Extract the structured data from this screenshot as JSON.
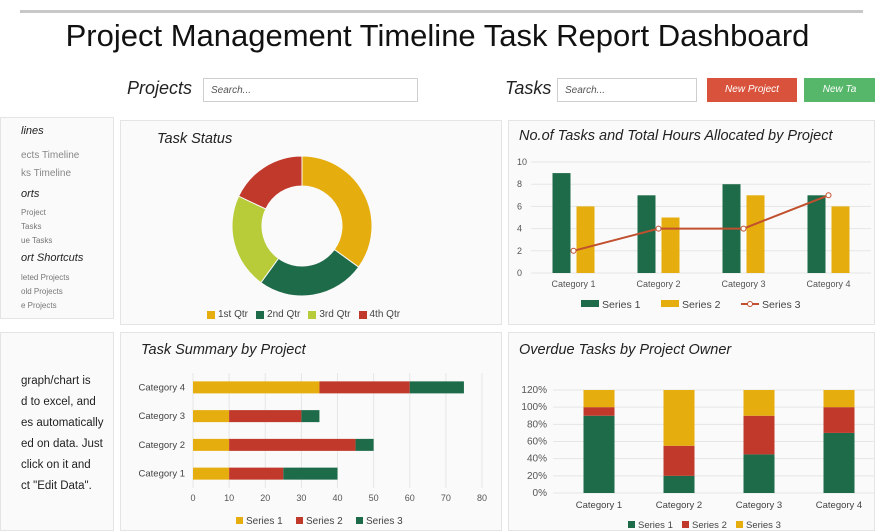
{
  "header": {
    "title": "Project Management Timeline Task Report Dashboard"
  },
  "toolbar": {
    "projects_label": "Projects",
    "projects_search_placeholder": "Search...",
    "tasks_label": "Tasks",
    "tasks_search_placeholder": "Search...",
    "new_project_label": "New Project",
    "new_task_label": "New Ta"
  },
  "sidebar": {
    "timelines_heading": "lines",
    "projects_timeline": "ects Timeline",
    "tasks_timeline": "ks Timeline",
    "reports_heading": "orts",
    "report_project": "Project",
    "report_tasks": "Tasks",
    "report_overdue": "ue Tasks",
    "shortcuts_heading": "ort Shortcuts",
    "shortcut_completed": "leted Projects",
    "shortcut_old": "old Projects",
    "shortcut_active": "e Projects"
  },
  "info": {
    "lines": [
      "graph/chart is",
      "d to excel, and",
      "es automatically",
      "ed on data. Just",
      "click on it and",
      "ct \"Edit Data\"."
    ]
  },
  "colors": {
    "green": "#1e6b4a",
    "gold": "#e5ad0e",
    "red": "#c0392b",
    "lime": "#b8cc3a",
    "line": "#c0502e"
  },
  "chart_data": [
    {
      "type": "pie",
      "title": "Task Status",
      "categories": [
        "1st Qtr",
        "2nd Qtr",
        "3rd Qtr",
        "4th Qtr"
      ],
      "values": [
        35,
        25,
        22,
        18
      ],
      "colors": [
        "#e5ad0e",
        "#1e6b4a",
        "#b8cc3a",
        "#c0392b"
      ]
    },
    {
      "type": "bar",
      "title": "No.of Tasks and Total Hours Allocated by Project",
      "categories": [
        "Category 1",
        "Category 2",
        "Category 3",
        "Category 4"
      ],
      "series": [
        {
          "name": "Series 1",
          "kind": "bar",
          "color": "#1e6b4a",
          "values": [
            9,
            7,
            8,
            7
          ]
        },
        {
          "name": "Series 2",
          "kind": "bar",
          "color": "#e5ad0e",
          "values": [
            6,
            5,
            7,
            6
          ]
        },
        {
          "name": "Series 3",
          "kind": "line",
          "color": "#c0502e",
          "values": [
            2,
            4,
            4,
            7
          ]
        }
      ],
      "ylim": [
        0,
        10
      ],
      "yticks": [
        "0",
        "2",
        "4",
        "6",
        "8",
        "10"
      ]
    },
    {
      "type": "bar",
      "orientation": "horizontal",
      "stacked": true,
      "title": "Task Summary  by Project",
      "categories": [
        "Category 1",
        "Category 2",
        "Category 3",
        "Category 4"
      ],
      "series": [
        {
          "name": "Series 1",
          "color": "#e5ad0e",
          "values": [
            10,
            10,
            10,
            35
          ]
        },
        {
          "name": "Series 2",
          "color": "#c0392b",
          "values": [
            15,
            35,
            20,
            25
          ]
        },
        {
          "name": "Series 3",
          "color": "#1e6b4a",
          "values": [
            15,
            5,
            5,
            15
          ]
        }
      ],
      "xlim": [
        0,
        80
      ],
      "xticks": [
        "0",
        "10",
        "20",
        "30",
        "40",
        "50",
        "60",
        "70",
        "80"
      ]
    },
    {
      "type": "bar",
      "stacked": true,
      "percent": true,
      "title": "Overdue Tasks by Project Owner",
      "categories": [
        "Category 1",
        "Category 2",
        "Category 3",
        "Category 4"
      ],
      "series": [
        {
          "name": "Series 1",
          "color": "#1e6b4a",
          "values": [
            90,
            20,
            45,
            70
          ]
        },
        {
          "name": "Series 2",
          "color": "#c0392b",
          "values": [
            10,
            35,
            45,
            30
          ]
        },
        {
          "name": "Series 3",
          "color": "#e5ad0e",
          "values": [
            20,
            65,
            30,
            20
          ]
        }
      ],
      "ylim": [
        0,
        120
      ],
      "yticks": [
        "0%",
        "20%",
        "40%",
        "60%",
        "80%",
        "100%",
        "120%"
      ]
    }
  ]
}
